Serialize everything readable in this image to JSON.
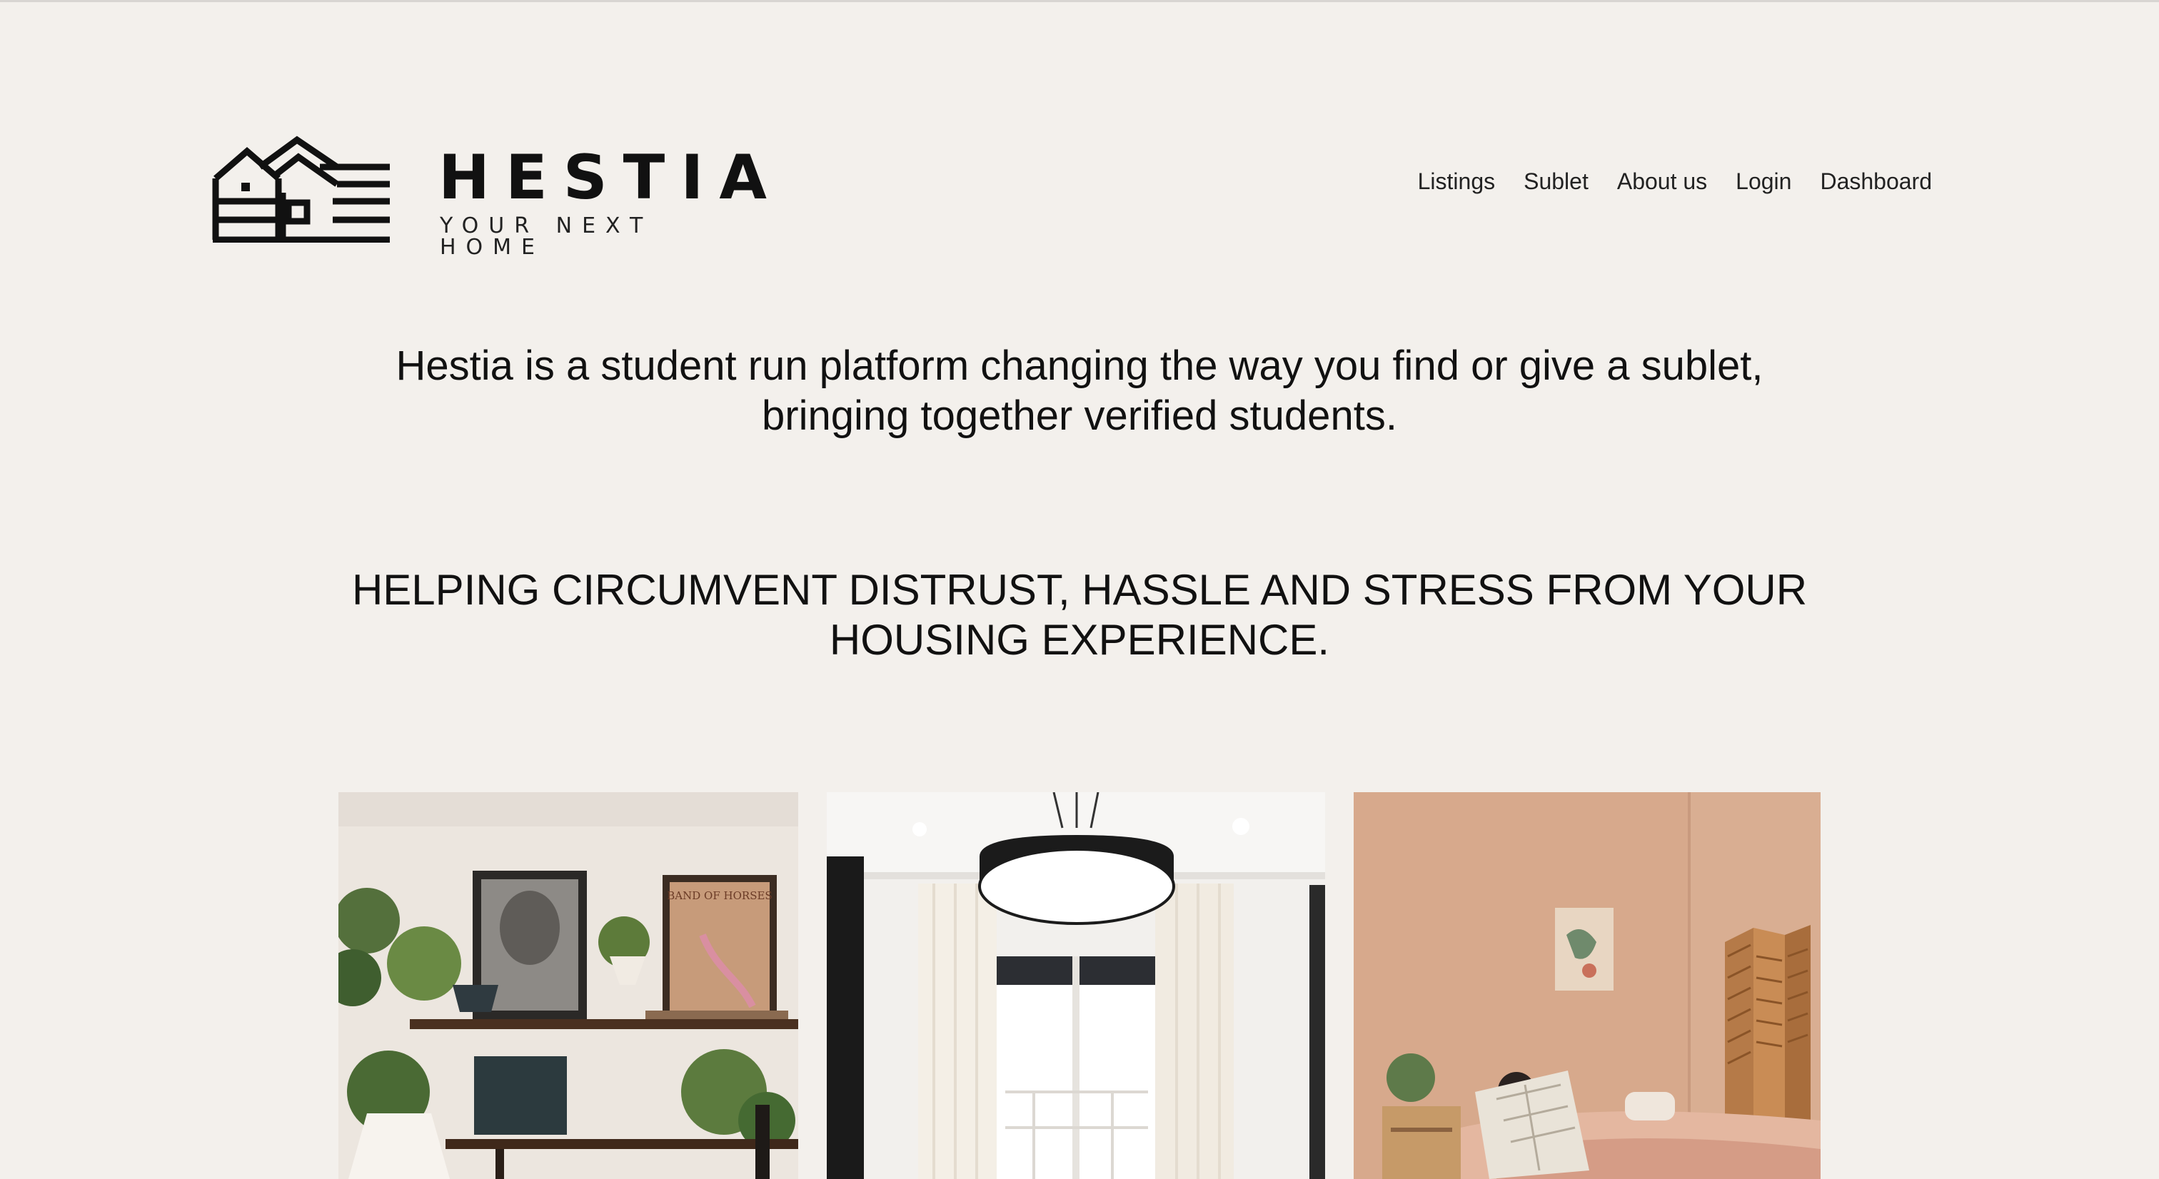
{
  "brand": {
    "name": "HESTIA",
    "tagline": "YOUR NEXT HOME",
    "logo_icon": "houses-logo-icon",
    "text_color": "#111111"
  },
  "nav": {
    "items": [
      {
        "label": "Listings"
      },
      {
        "label": "Sublet"
      },
      {
        "label": "About us"
      },
      {
        "label": "Login"
      },
      {
        "label": "Dashboard"
      }
    ]
  },
  "intro": {
    "line1": "Hestia is a student run platform changing the way you find or give a sublet,",
    "line2": "bringing together verified students."
  },
  "headline": {
    "line1": "HELPING CIRCUMVENT DISTRUST, HASSLE AND STRESS FROM YOUR",
    "line2": "HOUSING EXPERIENCE."
  },
  "gallery": {
    "photos": [
      {
        "subject": "shelves-with-plants-and-posters",
        "poster_text": "BAND OF HORSES"
      },
      {
        "subject": "pendant-lamp-and-window"
      },
      {
        "subject": "pink-bedroom-with-wall-art"
      }
    ]
  },
  "colors": {
    "background": "#f3f0ec",
    "text": "#111111"
  }
}
